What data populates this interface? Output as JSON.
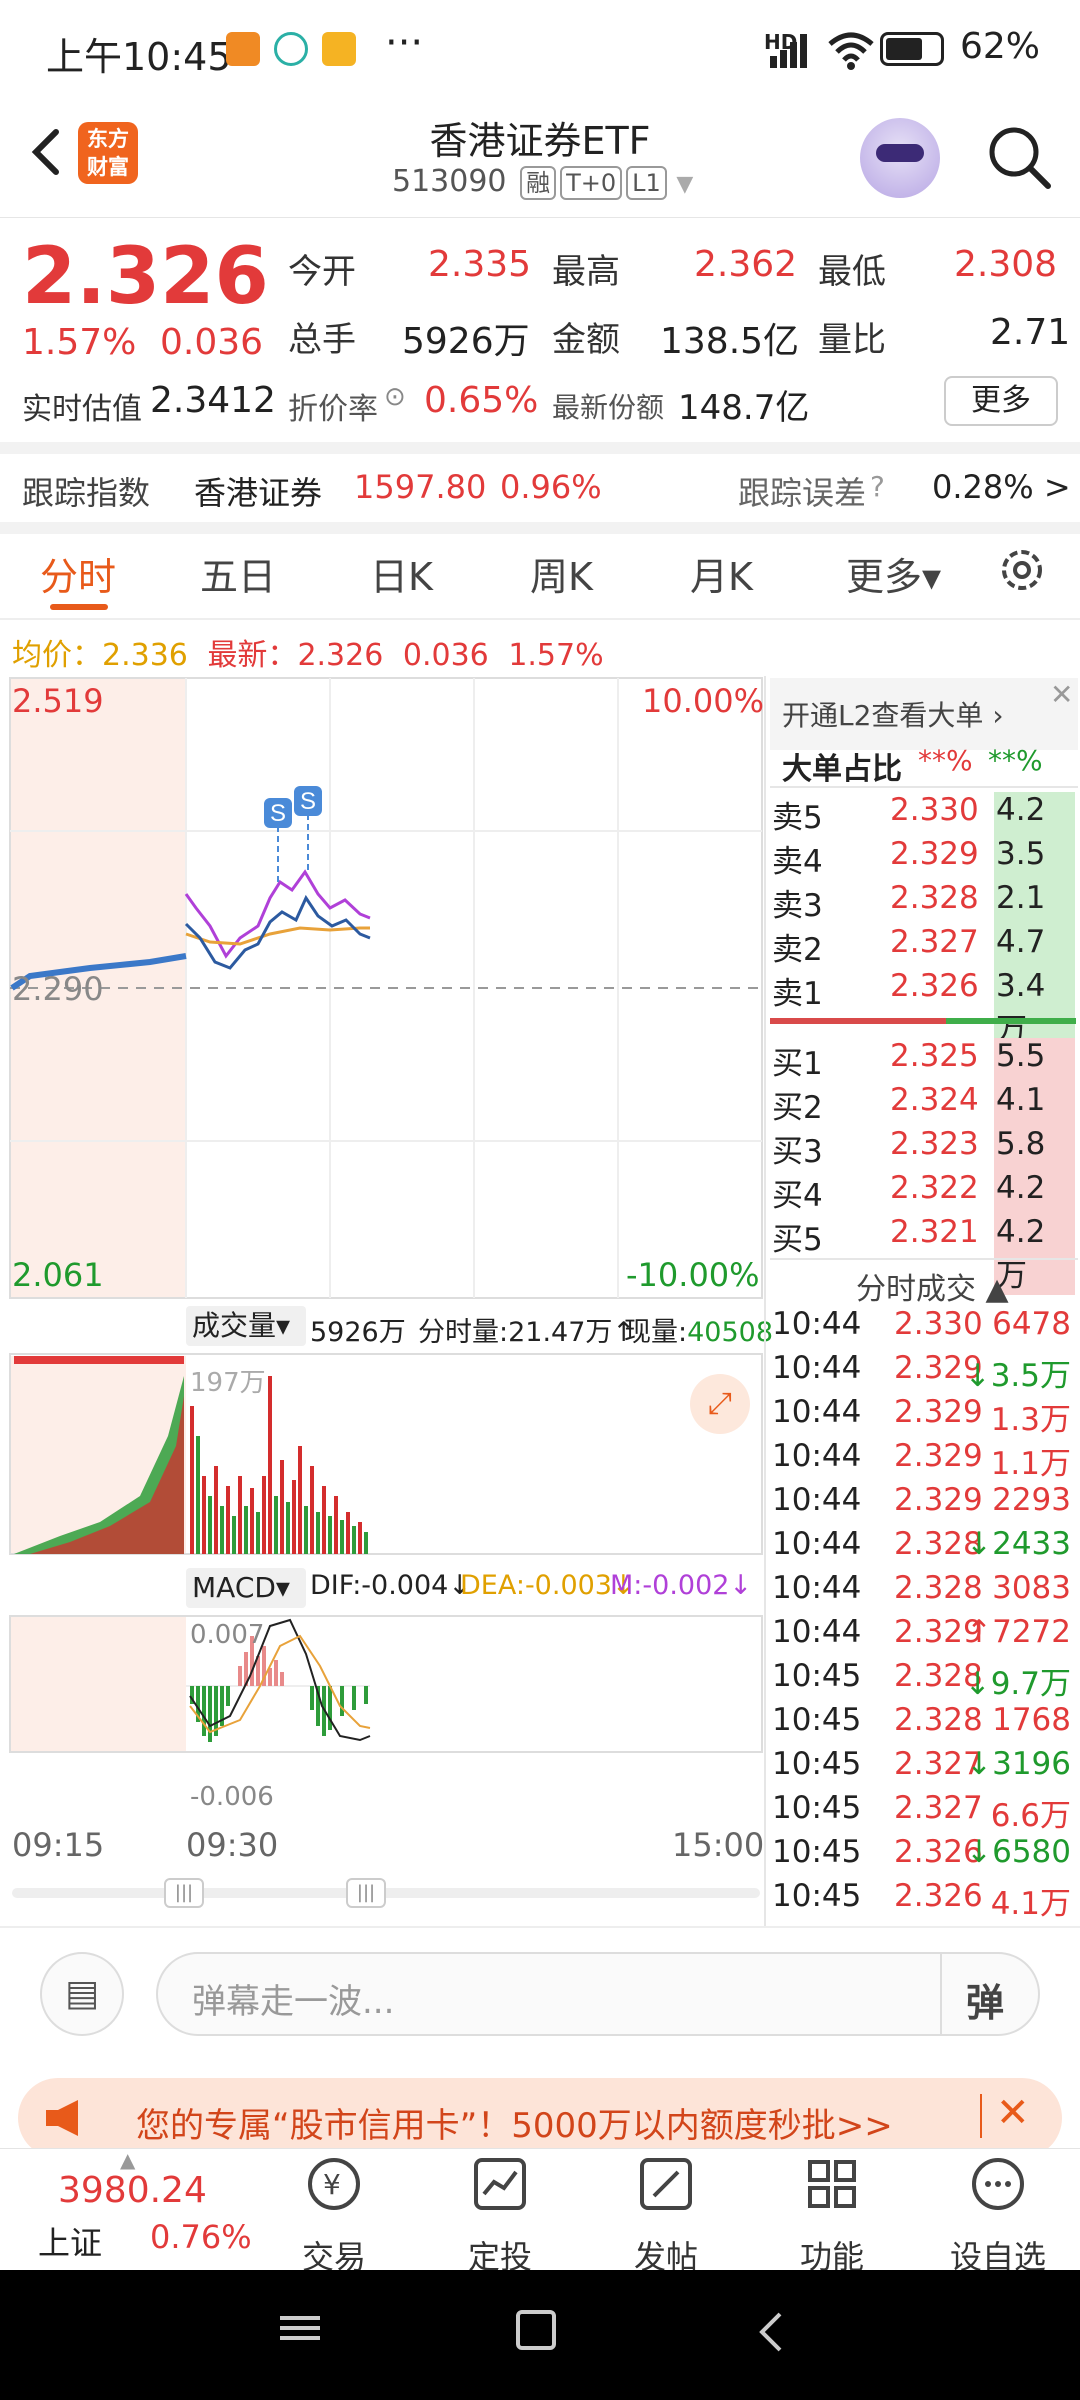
{
  "status": {
    "time": "上午10:45",
    "battery": "62%",
    "signal": "HD",
    "more": "···"
  },
  "header": {
    "logo_top": "东方",
    "logo_bottom": "财富",
    "title": "香港证券ETF",
    "code": "513090",
    "tags": [
      "融",
      "T+0",
      "L1"
    ]
  },
  "quote": {
    "price": "2.326",
    "change_pct": "1.57%",
    "change": "0.036",
    "labels": {
      "open": "今开",
      "high": "最高",
      "low": "最低",
      "volume": "总手",
      "amount": "金额",
      "vol_ratio": "量比",
      "iopv": "实时估值",
      "premium": "折价率",
      "shares": "最新份额"
    },
    "open": "2.335",
    "high": "2.362",
    "low": "2.308",
    "volume": "5926万",
    "amount": "138.5亿",
    "vol_ratio": "2.71",
    "iopv": "2.3412",
    "premium": "0.65%",
    "shares": "148.7亿",
    "more_label": "更多"
  },
  "tracking": {
    "label": "跟踪指数",
    "index": "香港证券",
    "value": "1597.80",
    "pct": "0.96%",
    "err_label": "跟踪误差",
    "err": "0.28% >"
  },
  "tabs": [
    "分时",
    "五日",
    "日K",
    "周K",
    "月K",
    "更多▾"
  ],
  "info_line": {
    "avg_label": "均价：",
    "avg": "2.336",
    "new_label": "最新：",
    "new": "2.326",
    "chg": "0.036",
    "pct": "1.57%"
  },
  "chart": {
    "y_top": "2.519",
    "y_mid": "2.290",
    "y_bot": "2.061",
    "pct_top": "10.00%",
    "pct_bot": "-10.00%",
    "vol_label": "成交量▾",
    "vol_total": "5926万",
    "vol_min": "分时量:21.47万↑",
    "vol_now_label": "现量:",
    "vol_now": "40508",
    "vol_max": "197万",
    "macd_label": "MACD▾",
    "dif": "DIF:-0.004↓",
    "dea": "DEA:-0.003↓",
    "m": "M:-0.002↓",
    "macd_top": "0.007",
    "macd_bot": "-0.006",
    "t_start": "09:15",
    "t_open": "09:30",
    "t_end": "15:00",
    "marker": "S"
  },
  "orderbook": {
    "promo": "开通L2查看大单 ›",
    "big_label": "大单占比",
    "big_red": "**%",
    "big_green": "**%",
    "asks": [
      {
        "label": "卖5",
        "price": "2.330",
        "vol": "4.2万"
      },
      {
        "label": "卖4",
        "price": "2.329",
        "vol": "3.5万"
      },
      {
        "label": "卖3",
        "price": "2.328",
        "vol": "2.1万"
      },
      {
        "label": "卖2",
        "price": "2.327",
        "vol": "4.7万"
      },
      {
        "label": "卖1",
        "price": "2.326",
        "vol": "3.4万"
      }
    ],
    "bids": [
      {
        "label": "买1",
        "price": "2.325",
        "vol": "5.5万"
      },
      {
        "label": "买2",
        "price": "2.324",
        "vol": "4.1万"
      },
      {
        "label": "买3",
        "price": "2.323",
        "vol": "5.8万"
      },
      {
        "label": "买4",
        "price": "2.322",
        "vol": "4.2万"
      },
      {
        "label": "买5",
        "price": "2.321",
        "vol": "4.2万"
      }
    ],
    "trades_label": "分时成交 ▲",
    "trades": [
      {
        "t": "10:44",
        "p": "2.330",
        "v": "6478"
      },
      {
        "t": "10:44",
        "p": "2.329",
        "v": "↓3.5万"
      },
      {
        "t": "10:44",
        "p": "2.329",
        "v": "1.3万"
      },
      {
        "t": "10:44",
        "p": "2.329",
        "v": "1.1万"
      },
      {
        "t": "10:44",
        "p": "2.329",
        "v": "2293"
      },
      {
        "t": "10:44",
        "p": "2.328",
        "v": "↓2433"
      },
      {
        "t": "10:44",
        "p": "2.328",
        "v": "3083"
      },
      {
        "t": "10:44",
        "p": "2.329",
        "v": "↑7272"
      },
      {
        "t": "10:45",
        "p": "2.328",
        "v": "↓9.7万"
      },
      {
        "t": "10:45",
        "p": "2.328",
        "v": "1768"
      },
      {
        "t": "10:45",
        "p": "2.327",
        "v": "↓3196"
      },
      {
        "t": "10:45",
        "p": "2.327",
        "v": "6.6万"
      },
      {
        "t": "10:45",
        "p": "2.326",
        "v": "↓6580"
      },
      {
        "t": "10:45",
        "p": "2.326",
        "v": "4.1万"
      }
    ]
  },
  "danmu": {
    "placeholder": "弹幕走一波...",
    "btn": "弹"
  },
  "promo": {
    "text": "您的专属“股市信用卡”！5000万以内额度秒批>>"
  },
  "tabbar": {
    "index_value": "3980.24",
    "index_name": "上证",
    "index_pct": "0.76%",
    "items": [
      "交易",
      "定投",
      "发帖",
      "功能",
      "设自选"
    ]
  },
  "colors": {
    "up": "#e23a3a",
    "down": "#1f9a2d",
    "accent": "#e85a1a"
  }
}
